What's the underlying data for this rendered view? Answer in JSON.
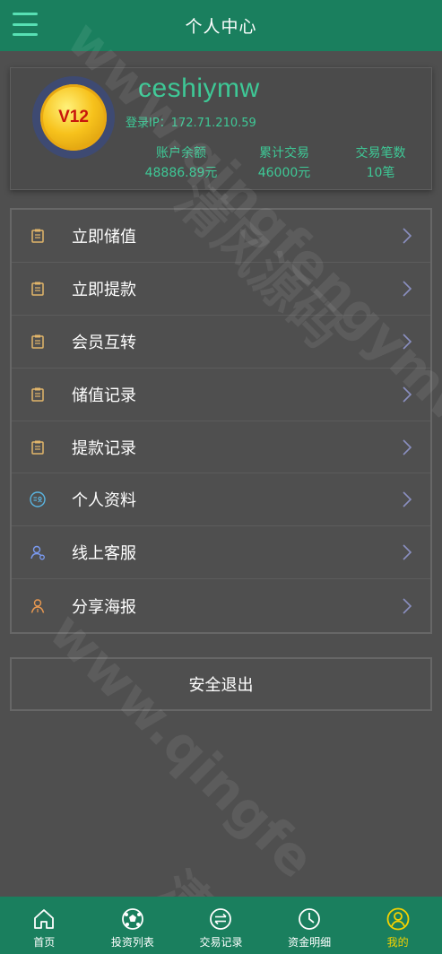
{
  "header": {
    "title": "个人中心"
  },
  "profile": {
    "badge": "V12",
    "username": "ceshiymw",
    "login_ip": "登录IP：172.71.210.59",
    "stats": [
      {
        "label": "账户余额",
        "value": "48886.89元"
      },
      {
        "label": "累计交易",
        "value": "46000元"
      },
      {
        "label": "交易笔数",
        "value": "10笔"
      }
    ]
  },
  "menu": {
    "items": [
      {
        "label": "立即储值",
        "icon": "clipboard-icon"
      },
      {
        "label": "立即提款",
        "icon": "clipboard-icon"
      },
      {
        "label": "会员互转",
        "icon": "clipboard-icon"
      },
      {
        "label": "储值记录",
        "icon": "clipboard-icon"
      },
      {
        "label": "提款记录",
        "icon": "clipboard-icon"
      },
      {
        "label": "个人资料",
        "icon": "id-card-icon"
      },
      {
        "label": "线上客服",
        "icon": "support-icon"
      },
      {
        "label": "分享海报",
        "icon": "user-share-icon"
      }
    ]
  },
  "logout": {
    "label": "安全退出"
  },
  "tabbar": {
    "items": [
      {
        "label": "首页",
        "icon": "home-icon"
      },
      {
        "label": "投资列表",
        "icon": "ball-icon"
      },
      {
        "label": "交易记录",
        "icon": "exchange-icon"
      },
      {
        "label": "资金明细",
        "icon": "clock-icon"
      },
      {
        "label": "我的",
        "icon": "user-icon"
      }
    ],
    "active_index": 4
  },
  "colors": {
    "header_bg": "#1a7f5e",
    "accent_green": "#3ec896",
    "active_tab": "#f5d200",
    "page_bg": "#4f4f4f"
  }
}
